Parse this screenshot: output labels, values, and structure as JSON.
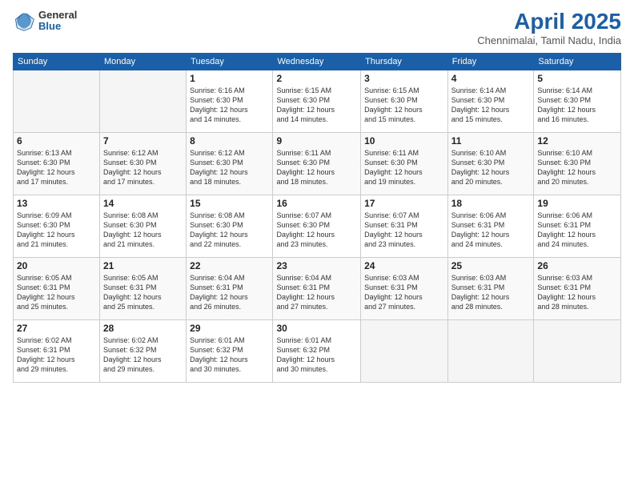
{
  "logo": {
    "general": "General",
    "blue": "Blue"
  },
  "title": "April 2025",
  "location": "Chennimalai, Tamil Nadu, India",
  "days_header": [
    "Sunday",
    "Monday",
    "Tuesday",
    "Wednesday",
    "Thursday",
    "Friday",
    "Saturday"
  ],
  "weeks": [
    [
      {
        "day": "",
        "info": ""
      },
      {
        "day": "",
        "info": ""
      },
      {
        "day": "1",
        "info": "Sunrise: 6:16 AM\nSunset: 6:30 PM\nDaylight: 12 hours\nand 14 minutes."
      },
      {
        "day": "2",
        "info": "Sunrise: 6:15 AM\nSunset: 6:30 PM\nDaylight: 12 hours\nand 14 minutes."
      },
      {
        "day": "3",
        "info": "Sunrise: 6:15 AM\nSunset: 6:30 PM\nDaylight: 12 hours\nand 15 minutes."
      },
      {
        "day": "4",
        "info": "Sunrise: 6:14 AM\nSunset: 6:30 PM\nDaylight: 12 hours\nand 15 minutes."
      },
      {
        "day": "5",
        "info": "Sunrise: 6:14 AM\nSunset: 6:30 PM\nDaylight: 12 hours\nand 16 minutes."
      }
    ],
    [
      {
        "day": "6",
        "info": "Sunrise: 6:13 AM\nSunset: 6:30 PM\nDaylight: 12 hours\nand 17 minutes."
      },
      {
        "day": "7",
        "info": "Sunrise: 6:12 AM\nSunset: 6:30 PM\nDaylight: 12 hours\nand 17 minutes."
      },
      {
        "day": "8",
        "info": "Sunrise: 6:12 AM\nSunset: 6:30 PM\nDaylight: 12 hours\nand 18 minutes."
      },
      {
        "day": "9",
        "info": "Sunrise: 6:11 AM\nSunset: 6:30 PM\nDaylight: 12 hours\nand 18 minutes."
      },
      {
        "day": "10",
        "info": "Sunrise: 6:11 AM\nSunset: 6:30 PM\nDaylight: 12 hours\nand 19 minutes."
      },
      {
        "day": "11",
        "info": "Sunrise: 6:10 AM\nSunset: 6:30 PM\nDaylight: 12 hours\nand 20 minutes."
      },
      {
        "day": "12",
        "info": "Sunrise: 6:10 AM\nSunset: 6:30 PM\nDaylight: 12 hours\nand 20 minutes."
      }
    ],
    [
      {
        "day": "13",
        "info": "Sunrise: 6:09 AM\nSunset: 6:30 PM\nDaylight: 12 hours\nand 21 minutes."
      },
      {
        "day": "14",
        "info": "Sunrise: 6:08 AM\nSunset: 6:30 PM\nDaylight: 12 hours\nand 21 minutes."
      },
      {
        "day": "15",
        "info": "Sunrise: 6:08 AM\nSunset: 6:30 PM\nDaylight: 12 hours\nand 22 minutes."
      },
      {
        "day": "16",
        "info": "Sunrise: 6:07 AM\nSunset: 6:30 PM\nDaylight: 12 hours\nand 23 minutes."
      },
      {
        "day": "17",
        "info": "Sunrise: 6:07 AM\nSunset: 6:31 PM\nDaylight: 12 hours\nand 23 minutes."
      },
      {
        "day": "18",
        "info": "Sunrise: 6:06 AM\nSunset: 6:31 PM\nDaylight: 12 hours\nand 24 minutes."
      },
      {
        "day": "19",
        "info": "Sunrise: 6:06 AM\nSunset: 6:31 PM\nDaylight: 12 hours\nand 24 minutes."
      }
    ],
    [
      {
        "day": "20",
        "info": "Sunrise: 6:05 AM\nSunset: 6:31 PM\nDaylight: 12 hours\nand 25 minutes."
      },
      {
        "day": "21",
        "info": "Sunrise: 6:05 AM\nSunset: 6:31 PM\nDaylight: 12 hours\nand 25 minutes."
      },
      {
        "day": "22",
        "info": "Sunrise: 6:04 AM\nSunset: 6:31 PM\nDaylight: 12 hours\nand 26 minutes."
      },
      {
        "day": "23",
        "info": "Sunrise: 6:04 AM\nSunset: 6:31 PM\nDaylight: 12 hours\nand 27 minutes."
      },
      {
        "day": "24",
        "info": "Sunrise: 6:03 AM\nSunset: 6:31 PM\nDaylight: 12 hours\nand 27 minutes."
      },
      {
        "day": "25",
        "info": "Sunrise: 6:03 AM\nSunset: 6:31 PM\nDaylight: 12 hours\nand 28 minutes."
      },
      {
        "day": "26",
        "info": "Sunrise: 6:03 AM\nSunset: 6:31 PM\nDaylight: 12 hours\nand 28 minutes."
      }
    ],
    [
      {
        "day": "27",
        "info": "Sunrise: 6:02 AM\nSunset: 6:31 PM\nDaylight: 12 hours\nand 29 minutes."
      },
      {
        "day": "28",
        "info": "Sunrise: 6:02 AM\nSunset: 6:32 PM\nDaylight: 12 hours\nand 29 minutes."
      },
      {
        "day": "29",
        "info": "Sunrise: 6:01 AM\nSunset: 6:32 PM\nDaylight: 12 hours\nand 30 minutes."
      },
      {
        "day": "30",
        "info": "Sunrise: 6:01 AM\nSunset: 6:32 PM\nDaylight: 12 hours\nand 30 minutes."
      },
      {
        "day": "",
        "info": ""
      },
      {
        "day": "",
        "info": ""
      },
      {
        "day": "",
        "info": ""
      }
    ]
  ]
}
